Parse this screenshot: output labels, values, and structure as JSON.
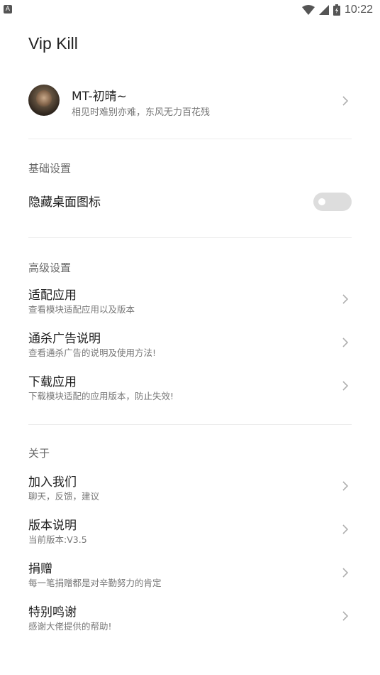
{
  "status_bar": {
    "time": "10:22",
    "left_icon": "android-notification-icon",
    "icons": [
      "wifi-icon",
      "signal-icon",
      "battery-icon"
    ]
  },
  "app": {
    "title": "Vip Kill"
  },
  "profile": {
    "name": "MT-初晴~",
    "motto": "相见时难别亦难，东风无力百花残"
  },
  "sections": {
    "basic": {
      "title": "基础设置",
      "hide_icon": {
        "label": "隐藏桌面图标",
        "enabled": false
      }
    },
    "advanced": {
      "title": "高级设置",
      "items": [
        {
          "title": "适配应用",
          "sub": "查看模块适配应用以及版本"
        },
        {
          "title": "通杀广告说明",
          "sub": "查看通杀广告的说明及使用方法!"
        },
        {
          "title": "下载应用",
          "sub": "下载模块适配的应用版本，防止失效!"
        }
      ]
    },
    "about": {
      "title": "关于",
      "items": [
        {
          "title": "加入我们",
          "sub": "聊天，反馈，建议"
        },
        {
          "title": "版本说明",
          "sub": "当前版本:V3.5"
        },
        {
          "title": "捐赠",
          "sub": "每一笔捐赠都是对辛勤努力的肯定"
        },
        {
          "title": "特别鸣谢",
          "sub": "感谢大佬提供的帮助!"
        }
      ]
    }
  },
  "colors": {
    "text": "#202020",
    "subtext": "#777777",
    "divider": "#ececec",
    "toggle_off": "#dddddd"
  }
}
